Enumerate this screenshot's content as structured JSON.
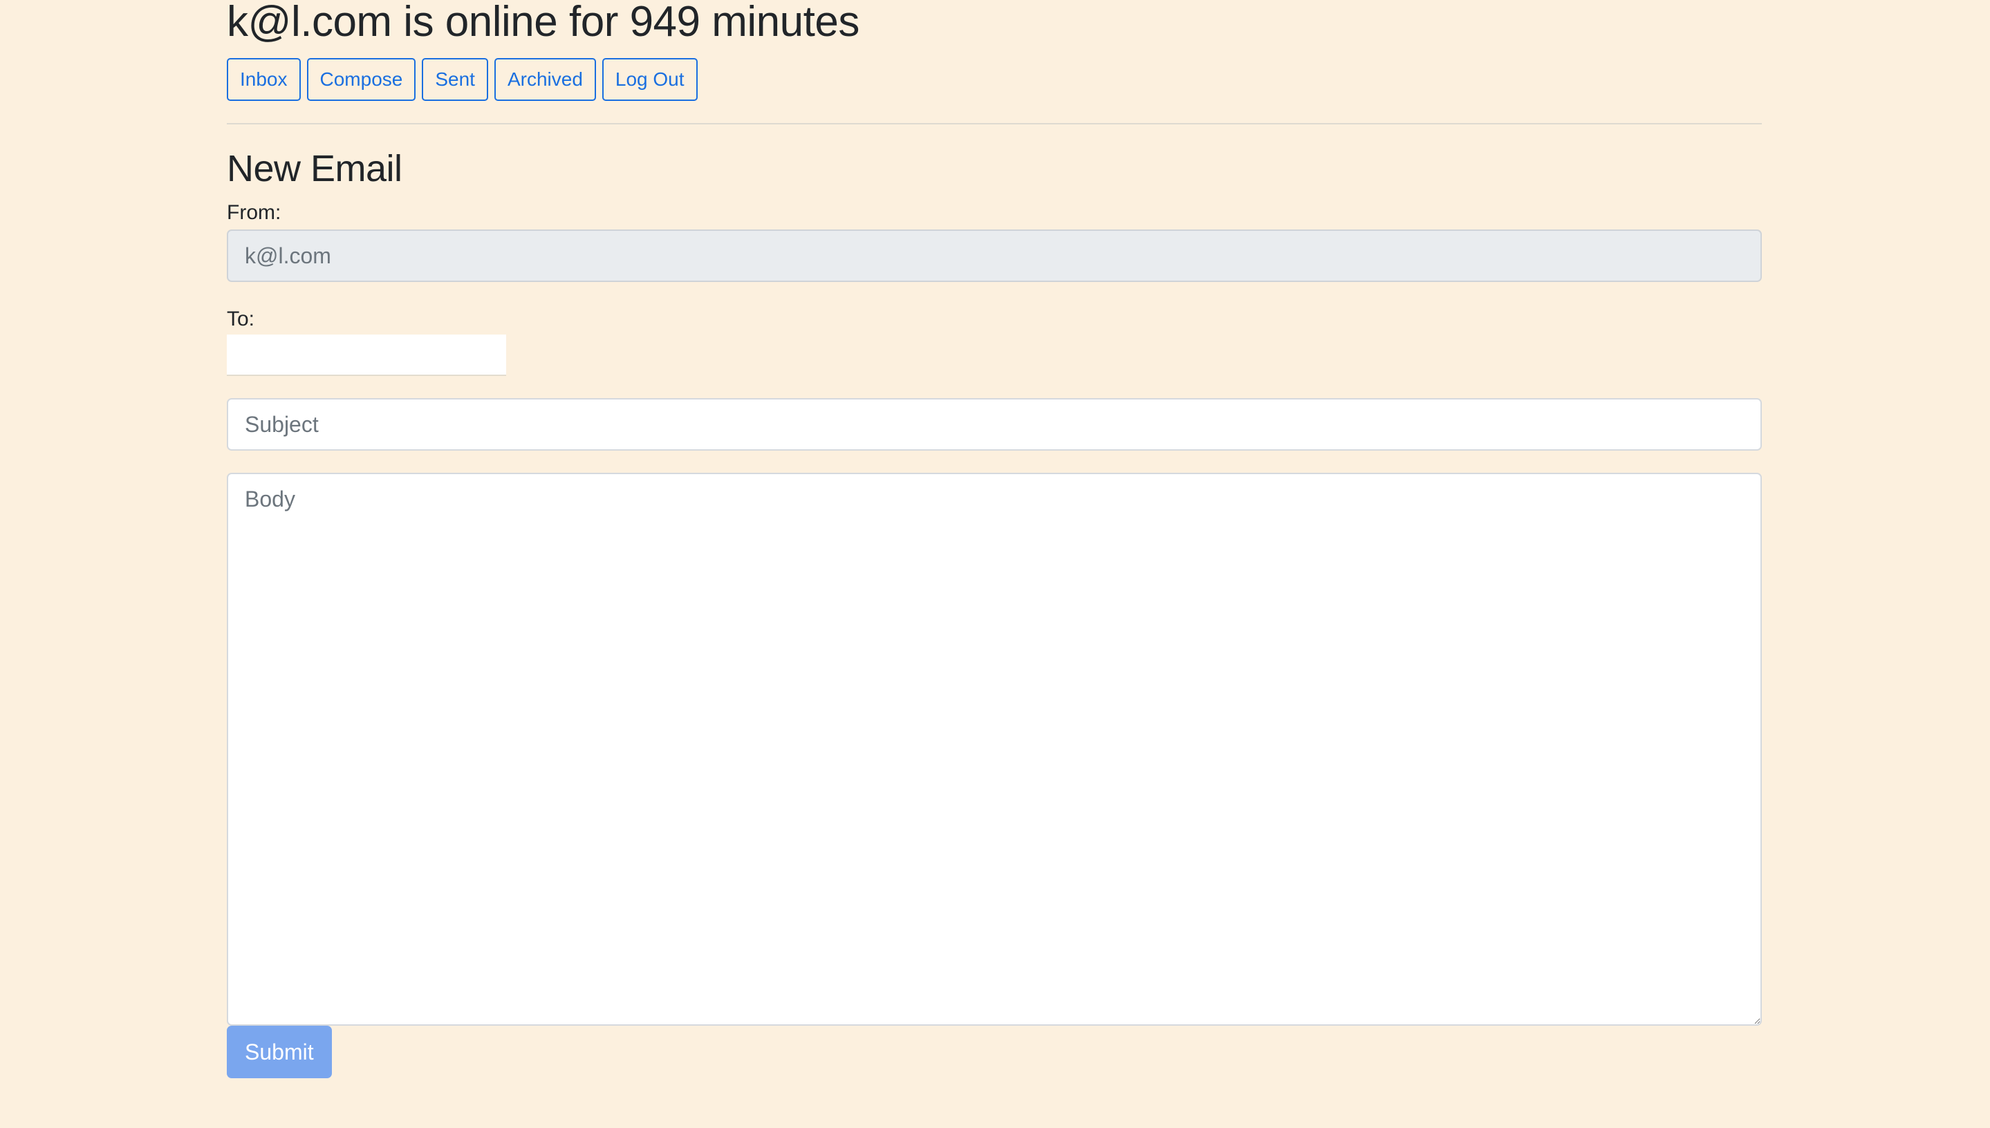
{
  "header": {
    "status_text": "k@l.com is online for 949 minutes"
  },
  "nav": {
    "inbox_label": "Inbox",
    "compose_label": "Compose",
    "sent_label": "Sent",
    "archived_label": "Archived",
    "logout_label": "Log Out"
  },
  "form": {
    "title": "New Email",
    "from_label": "From:",
    "from_value": "k@l.com",
    "to_label": "To:",
    "to_value": "",
    "subject_placeholder": "Subject",
    "subject_value": "",
    "body_placeholder": "Body",
    "body_value": "",
    "submit_label": "Submit"
  },
  "colors": {
    "background": "#fcf0de",
    "accent": "#1a6fe0",
    "submit": "#7aa6ee"
  }
}
